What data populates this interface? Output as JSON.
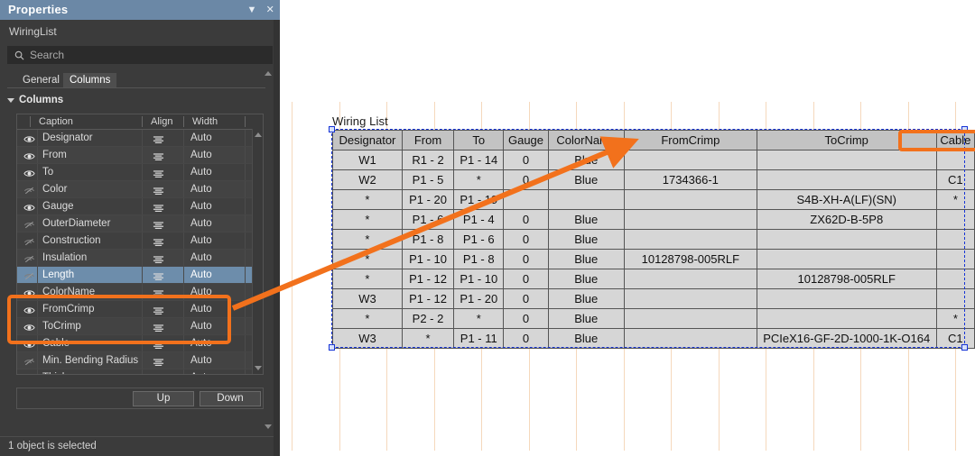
{
  "panel": {
    "title": "Properties",
    "title_buttons": [
      {
        "name": "menu-caret",
        "glyph": "▼"
      },
      {
        "name": "close",
        "glyph": "✕"
      }
    ],
    "object_name": "WiringList",
    "search": {
      "placeholder": "Search",
      "value": "",
      "icon": "search-icon"
    },
    "tabs": [
      {
        "label": "General",
        "active": false
      },
      {
        "label": "Columns",
        "active": true
      }
    ],
    "section": {
      "label": "Columns",
      "expanded": true
    },
    "grid": {
      "headers": [
        "Caption",
        "Align",
        "Width"
      ],
      "rows": [
        {
          "caption": "Designator",
          "visible": true,
          "align": "center",
          "width": "Auto",
          "selected": false,
          "highlighted": false
        },
        {
          "caption": "From",
          "visible": true,
          "align": "center",
          "width": "Auto",
          "selected": false,
          "highlighted": false
        },
        {
          "caption": "To",
          "visible": true,
          "align": "center",
          "width": "Auto",
          "selected": false,
          "highlighted": false
        },
        {
          "caption": "Color",
          "visible": false,
          "align": "center",
          "width": "Auto",
          "selected": false,
          "highlighted": false
        },
        {
          "caption": "Gauge",
          "visible": true,
          "align": "center",
          "width": "Auto",
          "selected": false,
          "highlighted": false
        },
        {
          "caption": "OuterDiameter",
          "visible": false,
          "align": "center",
          "width": "Auto",
          "selected": false,
          "highlighted": false
        },
        {
          "caption": "Construction",
          "visible": false,
          "align": "center",
          "width": "Auto",
          "selected": false,
          "highlighted": false
        },
        {
          "caption": "Insulation",
          "visible": false,
          "align": "center",
          "width": "Auto",
          "selected": false,
          "highlighted": false
        },
        {
          "caption": "Length",
          "visible": false,
          "align": "center",
          "width": "Auto",
          "selected": true,
          "highlighted": false
        },
        {
          "caption": "ColorName",
          "visible": true,
          "align": "center",
          "width": "Auto",
          "selected": false,
          "highlighted": false
        },
        {
          "caption": "FromCrimp",
          "visible": true,
          "align": "center",
          "width": "Auto",
          "selected": false,
          "highlighted": true
        },
        {
          "caption": "ToCrimp",
          "visible": true,
          "align": "center",
          "width": "Auto",
          "selected": false,
          "highlighted": true
        },
        {
          "caption": "Cable",
          "visible": true,
          "align": "center",
          "width": "Auto",
          "selected": false,
          "highlighted": true
        },
        {
          "caption": "Min. Bending Radius",
          "visible": false,
          "align": "center",
          "width": "Auto",
          "selected": false,
          "highlighted": false
        },
        {
          "caption": "Thickness",
          "visible": false,
          "align": "center",
          "width": "Auto",
          "selected": false,
          "highlighted": false
        }
      ]
    },
    "buttons": {
      "up": "Up",
      "down": "Down"
    },
    "status": "1 object is selected"
  },
  "canvas": {
    "table_caption": "Wiring List",
    "columns": [
      "Designator",
      "From",
      "To",
      "Gauge",
      "ColorName",
      "FromCrimp",
      "ToCrimp",
      "Cable"
    ],
    "rows": [
      [
        "W1",
        "R1 - 2",
        "P1 - 14",
        "0",
        "Blue",
        "",
        "",
        ""
      ],
      [
        "W2",
        "P1 - 5",
        "*",
        "0",
        "Blue",
        "1734366-1",
        "",
        "C1"
      ],
      [
        "*",
        "P1 - 20",
        "P1 - 19",
        "",
        "",
        "",
        "S4B-XH-A(LF)(SN)",
        "*"
      ],
      [
        "*",
        "P1 - 6",
        "P1 - 4",
        "0",
        "Blue",
        "",
        "ZX62D-B-5P8",
        ""
      ],
      [
        "*",
        "P1 - 8",
        "P1 - 6",
        "0",
        "Blue",
        "",
        "",
        ""
      ],
      [
        "*",
        "P1 - 10",
        "P1 - 8",
        "0",
        "Blue",
        "10128798-005RLF",
        "",
        ""
      ],
      [
        "*",
        "P1 - 12",
        "P1 - 10",
        "0",
        "Blue",
        "",
        "10128798-005RLF",
        ""
      ],
      [
        "W3",
        "P1 - 12",
        "P1 - 20",
        "0",
        "Blue",
        "",
        "",
        ""
      ],
      [
        "*",
        "P2 - 2",
        "*",
        "0",
        "Blue",
        "",
        "",
        "*"
      ],
      [
        "W3",
        "*",
        "P1 - 11",
        "0",
        "Blue",
        "",
        "PCIeX16-GF-2D-1000-1K-O164",
        "C1"
      ]
    ]
  },
  "annotation": {
    "color": "#f2711c",
    "description": "arrow linking highlighted column list rows to table header columns"
  },
  "colors": {
    "panel_bg": "#3b3b3b",
    "titlebar": "#6b88a6",
    "selection_row": "#6d8dab",
    "table_header": "#c3c3c3",
    "table_row": "#d6d6d6",
    "selection_dash": "#1533d6",
    "callout": "#f2711c"
  }
}
